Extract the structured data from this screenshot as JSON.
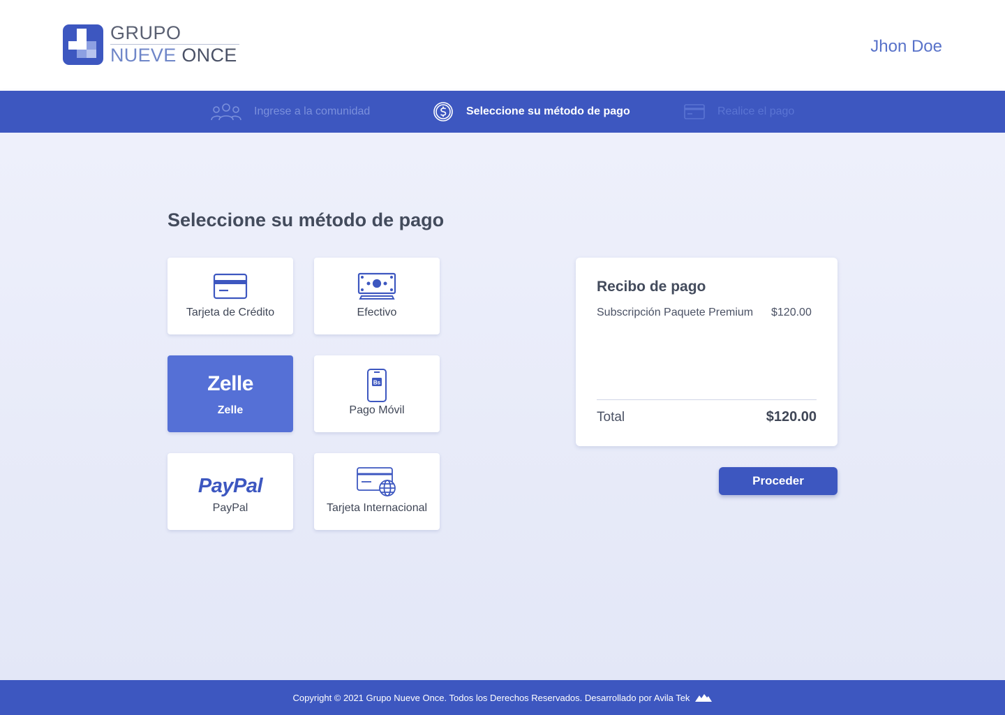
{
  "header": {
    "logo": {
      "line1": "GRUPO",
      "line2_part1": "NUEVE",
      "line2_part2": "ONCE"
    },
    "user_name": "Jhon Doe"
  },
  "steps": [
    {
      "label": "Ingrese a la comunidad",
      "icon": "community-icon",
      "state": "completed"
    },
    {
      "label": "Seleccione su método de pago",
      "icon": "dollar-coin-icon",
      "state": "active"
    },
    {
      "label": "Realice el pago",
      "icon": "card-icon",
      "state": "pending"
    }
  ],
  "main": {
    "title": "Seleccione su método de pago",
    "methods": [
      {
        "label": "Tarjeta de Crédito",
        "icon": "credit-card-icon",
        "selected": false
      },
      {
        "label": "Efectivo",
        "icon": "cash-icon",
        "selected": false
      },
      {
        "label": "Zelle",
        "icon": "zelle-logo",
        "logo_text": "Zelle",
        "selected": true
      },
      {
        "label": "Pago Móvil",
        "icon": "mobile-payment-icon",
        "icon_text": "Bs",
        "selected": false
      },
      {
        "label": "PayPal",
        "icon": "paypal-logo",
        "logo_text": "PayPal",
        "selected": false
      },
      {
        "label": "Tarjeta Internacional",
        "icon": "international-card-icon",
        "selected": false
      }
    ]
  },
  "receipt": {
    "title": "Recibo de pago",
    "item_name": "Subscripción Paquete Premium",
    "item_price": "$120.00",
    "total_label": "Total",
    "total_value": "$120.00"
  },
  "actions": {
    "proceed_label": "Proceder"
  },
  "footer": {
    "text": "Copyright © 2021 Grupo Nueve Once. Todos los Derechos Reservados. Desarrollado por Avila Tek"
  },
  "colors": {
    "primary": "#3d57c0",
    "selected_card": "#5570d6",
    "background": "#eef0fb",
    "user_name": "#5872c9"
  }
}
